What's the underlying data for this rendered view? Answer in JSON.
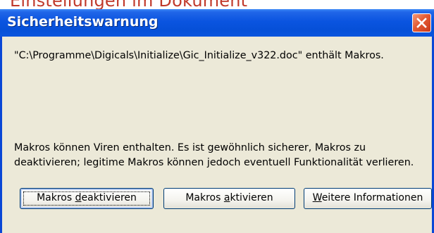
{
  "background": {
    "fragment_text": "Einstellungen im Dokument"
  },
  "dialog": {
    "title": "Sicherheitswarnung",
    "file_message": "\"C:\\Programme\\Digicals\\Initialize\\Gic_Initialize_v322.doc\" enthält Makros.",
    "warning_line_1": "Makros können Viren enthalten. Es ist gewöhnlich sicherer, Makros zu",
    "warning_line_2": "deaktivieren; legitime Makros können jedoch eventuell Funktionalität verlieren.",
    "buttons": {
      "deactivate": {
        "pre": "Makros ",
        "accel": "d",
        "post": "eaktivieren"
      },
      "activate": {
        "pre": "Makros ",
        "accel": "a",
        "post": "ktivieren"
      },
      "more_info": {
        "pre": "",
        "accel": "W",
        "post": "eitere Informationen"
      }
    },
    "close_icon": "close-x-icon"
  },
  "colors": {
    "titlebar": "#0a54e0",
    "window_bg": "#ece9d8",
    "close_button": "#e45a32",
    "background_text": "#c0392b"
  }
}
